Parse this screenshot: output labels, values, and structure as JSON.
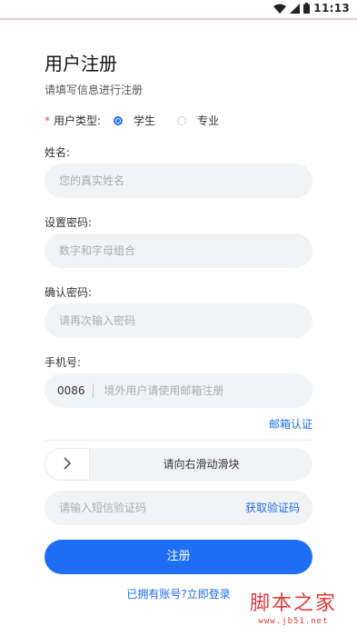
{
  "status_bar": {
    "time": "11:13",
    "icons": [
      "wifi-icon",
      "signal-icon",
      "battery-icon"
    ]
  },
  "header": {
    "title": "用户注册",
    "subtitle": "请填写信息进行注册"
  },
  "user_type": {
    "required_mark": "*",
    "label": "用户类型:",
    "options": [
      {
        "label": "学生",
        "selected": true
      },
      {
        "label": "专业",
        "selected": false
      }
    ]
  },
  "fields": {
    "name": {
      "label": "姓名:",
      "placeholder": "您的真实姓名",
      "value": ""
    },
    "password": {
      "label": "设置密码:",
      "placeholder": "数字和字母组合",
      "value": ""
    },
    "confirm_password": {
      "label": "确认密码:",
      "placeholder": "请再次输入密码",
      "value": ""
    },
    "phone": {
      "label": "手机号:",
      "prefix": "0086",
      "placeholder": "境外用户请使用邮箱注册",
      "value": ""
    },
    "sms_code": {
      "placeholder": "请输入短信验证码",
      "value": "",
      "button": "获取验证码"
    }
  },
  "email_link": "邮箱认证",
  "slider": {
    "text": "请向右滑动滑块",
    "handle_icon": "chevron-right-icon"
  },
  "register_button": "注册",
  "login_link": "已拥有账号?立即登录",
  "watermark": {
    "main": "脚本之家",
    "sub": "www.jb51.net"
  },
  "colors": {
    "primary": "#1e6ef5",
    "input_bg": "#f2f3f5",
    "required": "#e74c3c",
    "watermark": "#e23a3a"
  }
}
